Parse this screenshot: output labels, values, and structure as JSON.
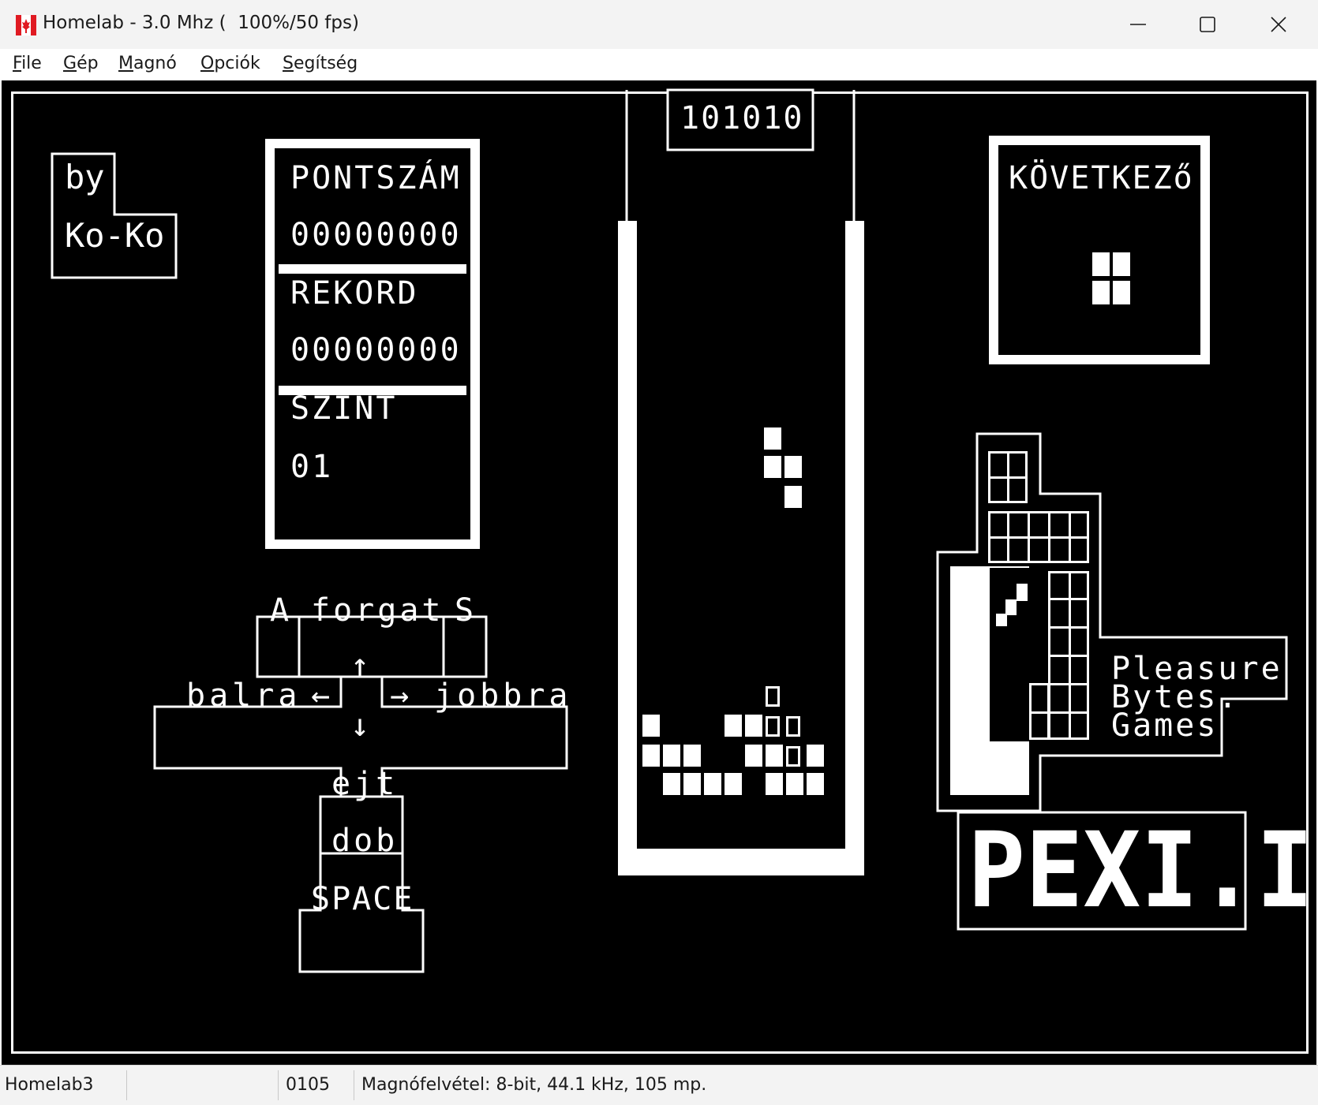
{
  "window": {
    "title": "Homelab - 3.0 Mhz (  100%/50 fps)",
    "app_icon": "canada-flag-icon",
    "controls": [
      "minimize-icon",
      "maximize-icon",
      "close-icon"
    ]
  },
  "menu": [
    {
      "label": "File",
      "underline": "F"
    },
    {
      "label": "Gép",
      "underline": "G"
    },
    {
      "label": "Magnó",
      "underline": "M"
    },
    {
      "label": "Opciók",
      "underline": "O"
    },
    {
      "label": "Segítség",
      "underline": "S"
    }
  ],
  "game": {
    "credit_by": "by",
    "credit_author": "Ko-Ko",
    "score_label": "PONTSZÁM",
    "score_value": "00000000",
    "record_label": "REKORD",
    "record_value": "00000000",
    "level_label": "SZINT",
    "level_value": "01",
    "lines_counter": "101010",
    "next_label": "KÖVETKEZő",
    "controls": {
      "rotate_key_left": "A",
      "rotate_label": "forgat",
      "rotate_key_right": "S",
      "left_label": "balra",
      "left_arrow": "←",
      "right_arrow": "→",
      "right_label": "jobbra",
      "up_arrow": "↑",
      "down_arrow": "↓",
      "drop_slow_label": "ejt",
      "drop_label": "dob",
      "drop_key": "SPACE"
    },
    "publisher_lines": [
      "Pleasure",
      "Bytes.",
      "Games"
    ],
    "website": "PEXI.IO"
  },
  "status": {
    "machine": "Homelab3",
    "empty": "",
    "address": "0105",
    "tape": "Magnófelvétel: 8-bit, 44.1 kHz, 105 mp."
  },
  "colors": {
    "screen_bg": "#000000",
    "screen_fg": "#ffffff",
    "chrome_bg": "#f3f3f3",
    "flag_red": "#e01a22"
  }
}
